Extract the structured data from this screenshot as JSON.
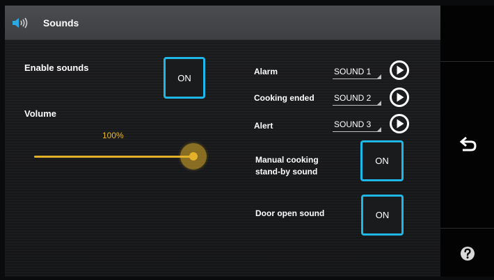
{
  "header": {
    "title": "Sounds",
    "icon": "speaker-icon"
  },
  "left_panel": {
    "enable_label": "Enable sounds",
    "enable_value": "ON",
    "volume_label": "Volume",
    "volume_value_text": "100%",
    "volume_level": 1.0
  },
  "sounds": [
    {
      "label": "Alarm",
      "value": "SOUND 1",
      "play_icon": "play-icon"
    },
    {
      "label": "Cooking ended",
      "value": "SOUND 2",
      "play_icon": "play-icon"
    },
    {
      "label": "Alert",
      "value": "SOUND 3",
      "play_icon": "play-icon"
    }
  ],
  "toggles": {
    "standby_label_line1": "Manual cooking",
    "standby_label_line2": "stand-by sound",
    "standby_value": "ON",
    "door_label": "Door open sound",
    "door_value": "ON"
  },
  "sidebar": {
    "back_icon": "back-arrow-icon",
    "help_icon": "help-icon"
  },
  "colors": {
    "accent": "#1fb6e8",
    "slider": "#e3b12a",
    "header": "#434548"
  }
}
